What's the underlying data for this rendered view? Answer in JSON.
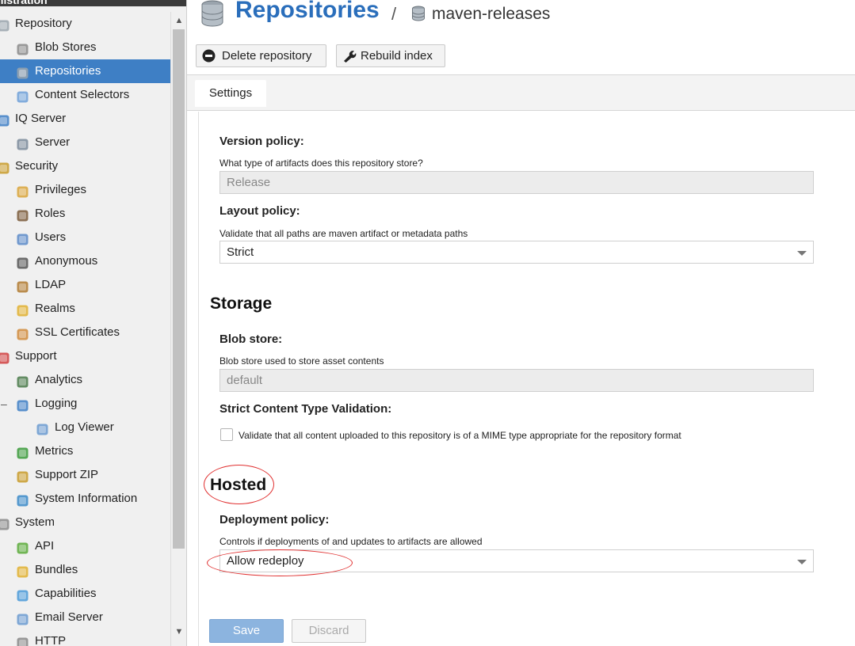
{
  "sidebar": {
    "header": "inistration",
    "items": [
      {
        "label": "Repository",
        "icon": "database-icon"
      },
      {
        "label": "Blob Stores",
        "icon": "blob-store-icon"
      },
      {
        "label": "Repositories",
        "icon": "database-icon",
        "selected": true
      },
      {
        "label": "Content Selectors",
        "icon": "content-selector-icon"
      },
      {
        "label": "IQ Server",
        "icon": "iq-server-icon"
      },
      {
        "label": "Server",
        "icon": "server-icon"
      },
      {
        "label": "Security",
        "icon": "security-icon"
      },
      {
        "label": "Privileges",
        "icon": "medal-icon"
      },
      {
        "label": "Roles",
        "icon": "role-icon"
      },
      {
        "label": "Users",
        "icon": "users-icon"
      },
      {
        "label": "Anonymous",
        "icon": "anonymous-icon"
      },
      {
        "label": "LDAP",
        "icon": "book-icon"
      },
      {
        "label": "Realms",
        "icon": "shield-icon"
      },
      {
        "label": "SSL Certificates",
        "icon": "certificate-icon"
      },
      {
        "label": "Support",
        "icon": "lifebuoy-icon"
      },
      {
        "label": "Analytics",
        "icon": "analytics-icon"
      },
      {
        "label": "Logging",
        "icon": "logging-icon"
      },
      {
        "label": "Log Viewer",
        "icon": "log-viewer-icon"
      },
      {
        "label": "Metrics",
        "icon": "pie-chart-icon"
      },
      {
        "label": "Support ZIP",
        "icon": "zip-icon"
      },
      {
        "label": "System Information",
        "icon": "globe-icon"
      },
      {
        "label": "System",
        "icon": "gear-icon"
      },
      {
        "label": "API",
        "icon": "api-icon"
      },
      {
        "label": "Bundles",
        "icon": "puzzle-icon"
      },
      {
        "label": "Capabilities",
        "icon": "cube-icon"
      },
      {
        "label": "Email Server",
        "icon": "envelope-icon"
      },
      {
        "label": "HTTP",
        "icon": "http-icon"
      }
    ]
  },
  "header": {
    "title": "Repositories",
    "separator": "/",
    "subtitle": "maven-releases"
  },
  "toolbar": {
    "delete_label": "Delete repository",
    "rebuild_label": "Rebuild index"
  },
  "tabs": {
    "settings": "Settings"
  },
  "form": {
    "version_policy": {
      "label": "Version policy:",
      "help": "What type of artifacts does this repository store?",
      "value": "Release"
    },
    "layout_policy": {
      "label": "Layout policy:",
      "help": "Validate that all paths are maven artifact or metadata paths",
      "value": "Strict"
    },
    "storage": {
      "title": "Storage",
      "blob_store_label": "Blob store:",
      "blob_store_help": "Blob store used to store asset contents",
      "blob_store_value": "default",
      "strict_label": "Strict Content Type Validation:",
      "strict_checkbox_text": "Validate that all content uploaded to this repository is of a MIME type appropriate for the repository format",
      "strict_checked": false
    },
    "hosted": {
      "title": "Hosted",
      "deployment_label": "Deployment policy:",
      "deployment_help": "Controls if deployments of and updates to artifacts are allowed",
      "deployment_value": "Allow redeploy"
    },
    "save_label": "Save",
    "discard_label": "Discard"
  },
  "colors": {
    "accent": "#2a6ebb",
    "selected": "#3e7fc5",
    "annotation": "#e03030"
  }
}
